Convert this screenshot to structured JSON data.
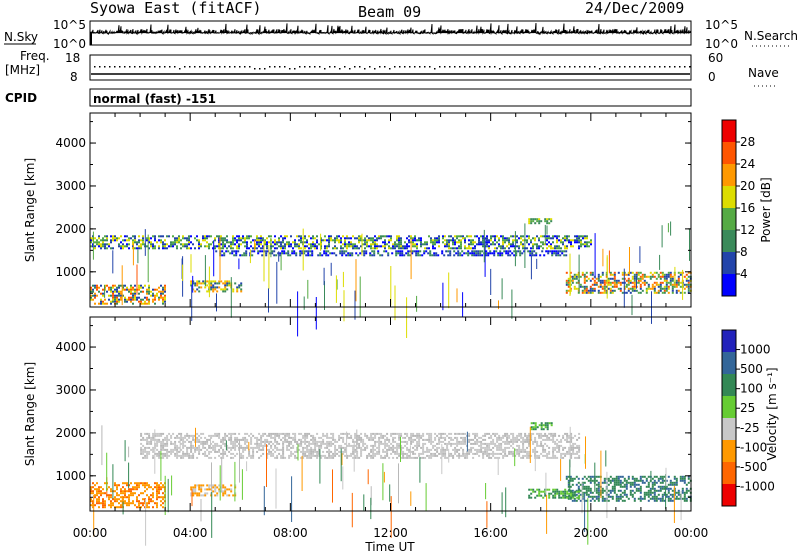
{
  "header": {
    "station": "Syowa East (fitACF)",
    "beam": "Beam 09",
    "date": "24/Dec/2009"
  },
  "strips": {
    "nsky_label": "N.Sky",
    "nsearch_label": "N.Search",
    "nsky_ticks": [
      "10^5",
      "10^0"
    ],
    "nsearch_ticks": [
      "10^5",
      "10^0"
    ],
    "freq_label_1": "Freq.",
    "freq_label_2": "[MHz]",
    "freq_ticks": [
      "18",
      "8"
    ],
    "nave_label": "Nave",
    "nave_ticks": [
      "60",
      "0"
    ],
    "cpid_label": "CPID",
    "cpid_value": "normal (fast) -151"
  },
  "colors": {
    "power": [
      "#0000ff",
      "#2244aa",
      "#3a8a5a",
      "#55aa44",
      "#dddd00",
      "#ff9900",
      "#ff5500",
      "#ee0000"
    ],
    "velocity": [
      "#2222bb",
      "#336699",
      "#338855",
      "#66cc33",
      "#c8c8c8",
      "#ff9900",
      "#ff6600",
      "#ee0000"
    ]
  },
  "chart_data": [
    {
      "type": "heatmap",
      "title": "",
      "xlabel": "Time UT",
      "ylabel": "Slant Range [km]",
      "xlim": [
        "00:00",
        "24:00"
      ],
      "ylim": [
        180,
        4700
      ],
      "x_ticks": [
        "00:00",
        "04:00",
        "08:00",
        "12:00",
        "16:00",
        "20:00",
        "00:00"
      ],
      "y_ticks": [
        "1000",
        "2000",
        "3000",
        "4000"
      ],
      "colorbar": {
        "label": "Power [dB]",
        "ticks": [
          "4",
          "8",
          "12",
          "16",
          "20",
          "24",
          "28"
        ],
        "range": [
          0,
          30
        ]
      },
      "echo_regions": [
        {
          "t": [
            0.0,
            3.0
          ],
          "range": [
            250,
            700
          ],
          "value": "12-24"
        },
        {
          "t": [
            4.0,
            6.0
          ],
          "range": [
            550,
            800
          ],
          "value": "12-20"
        },
        {
          "t": [
            0.0,
            20.0
          ],
          "range": [
            1550,
            1850
          ],
          "value": "4-20"
        },
        {
          "t": [
            5.0,
            19.0
          ],
          "range": [
            1400,
            1500
          ],
          "value": "4-12"
        },
        {
          "t": [
            19.0,
            24.0
          ],
          "range": [
            500,
            1000
          ],
          "value": "8-24"
        },
        {
          "t": [
            17.5,
            18.5
          ],
          "range": [
            2150,
            2250
          ],
          "value": "12-20"
        }
      ]
    },
    {
      "type": "heatmap",
      "title": "",
      "xlabel": "Time UT",
      "ylabel": "Slant Range [km]",
      "xlim": [
        "00:00",
        "24:00"
      ],
      "ylim": [
        180,
        4700
      ],
      "x_ticks": [
        "00:00",
        "04:00",
        "08:00",
        "12:00",
        "16:00",
        "20:00",
        "00:00"
      ],
      "y_ticks": [
        "1000",
        "2000",
        "3000",
        "4000"
      ],
      "colorbar": {
        "label": "Velocity [m s⁻¹]",
        "ticks": [
          "1000",
          "500",
          "100",
          "25",
          "-25",
          "-100",
          "-500",
          "-1000"
        ],
        "range": [
          -1000,
          1000
        ]
      },
      "echo_regions": [
        {
          "t": [
            0.0,
            3.0
          ],
          "range": [
            250,
            850
          ],
          "value": "-100 to -500"
        },
        {
          "t": [
            4.0,
            5.8
          ],
          "range": [
            550,
            800
          ],
          "value": "-100 to -500"
        },
        {
          "t": [
            2.0,
            19.5
          ],
          "range": [
            1400,
            2000
          ],
          "value": "-25 to 25"
        },
        {
          "t": [
            19.0,
            24.0
          ],
          "range": [
            400,
            1000
          ],
          "value": "100 to 500"
        },
        {
          "t": [
            17.5,
            19.5
          ],
          "range": [
            500,
            700
          ],
          "value": "25 to 100"
        },
        {
          "t": [
            17.6,
            18.4
          ],
          "range": [
            2100,
            2250
          ],
          "value": "100"
        }
      ]
    }
  ]
}
